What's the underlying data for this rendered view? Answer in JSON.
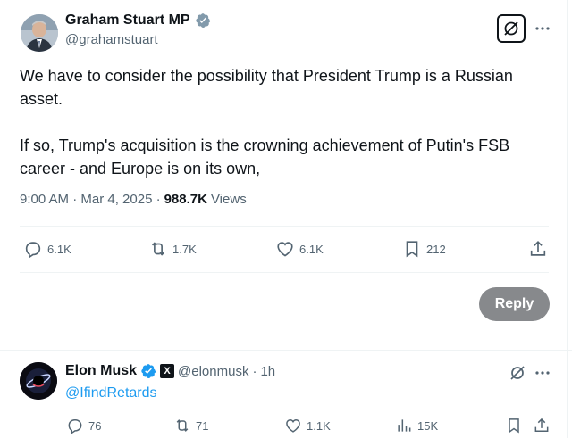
{
  "post": {
    "author": {
      "name": "Graham Stuart MP",
      "handle": "@grahamstuart",
      "verified_color": "#829aab"
    },
    "text": "We have to consider the possibility that President Trump is a Russian asset.\n\nIf so, Trump's acquisition is the crowning achievement of Putin's FSB career - and  Europe is on its own,",
    "timestamp": "9:00 AM · Mar 4, 2025 ·",
    "views": {
      "count": "988.7K",
      "label": "Views"
    },
    "actions": {
      "replies": "6.1K",
      "reposts": "1.7K",
      "likes": "6.1K",
      "bookmarks": "212"
    },
    "reply_button": "Reply"
  },
  "reply": {
    "author": {
      "name": "Elon Musk",
      "handle": "@elonmusk",
      "separator": "·",
      "time": "1h",
      "verified_color": "#1d9bf0",
      "affiliate_badge": "X"
    },
    "text": "@IfindRetards",
    "actions": {
      "replies": "76",
      "reposts": "71",
      "likes": "1.1K",
      "views": "15K"
    }
  },
  "colors": {
    "text_primary": "#0f1419",
    "text_secondary": "#536471",
    "link": "#1d9bf0",
    "reply_button_bg": "#87898c",
    "divider": "#eff3f4"
  },
  "icons": [
    "verified-badge-icon",
    "grok-icon",
    "more-icon",
    "reply-icon",
    "repost-icon",
    "like-icon",
    "bookmark-icon",
    "share-icon",
    "views-icon",
    "x-logo-icon"
  ]
}
